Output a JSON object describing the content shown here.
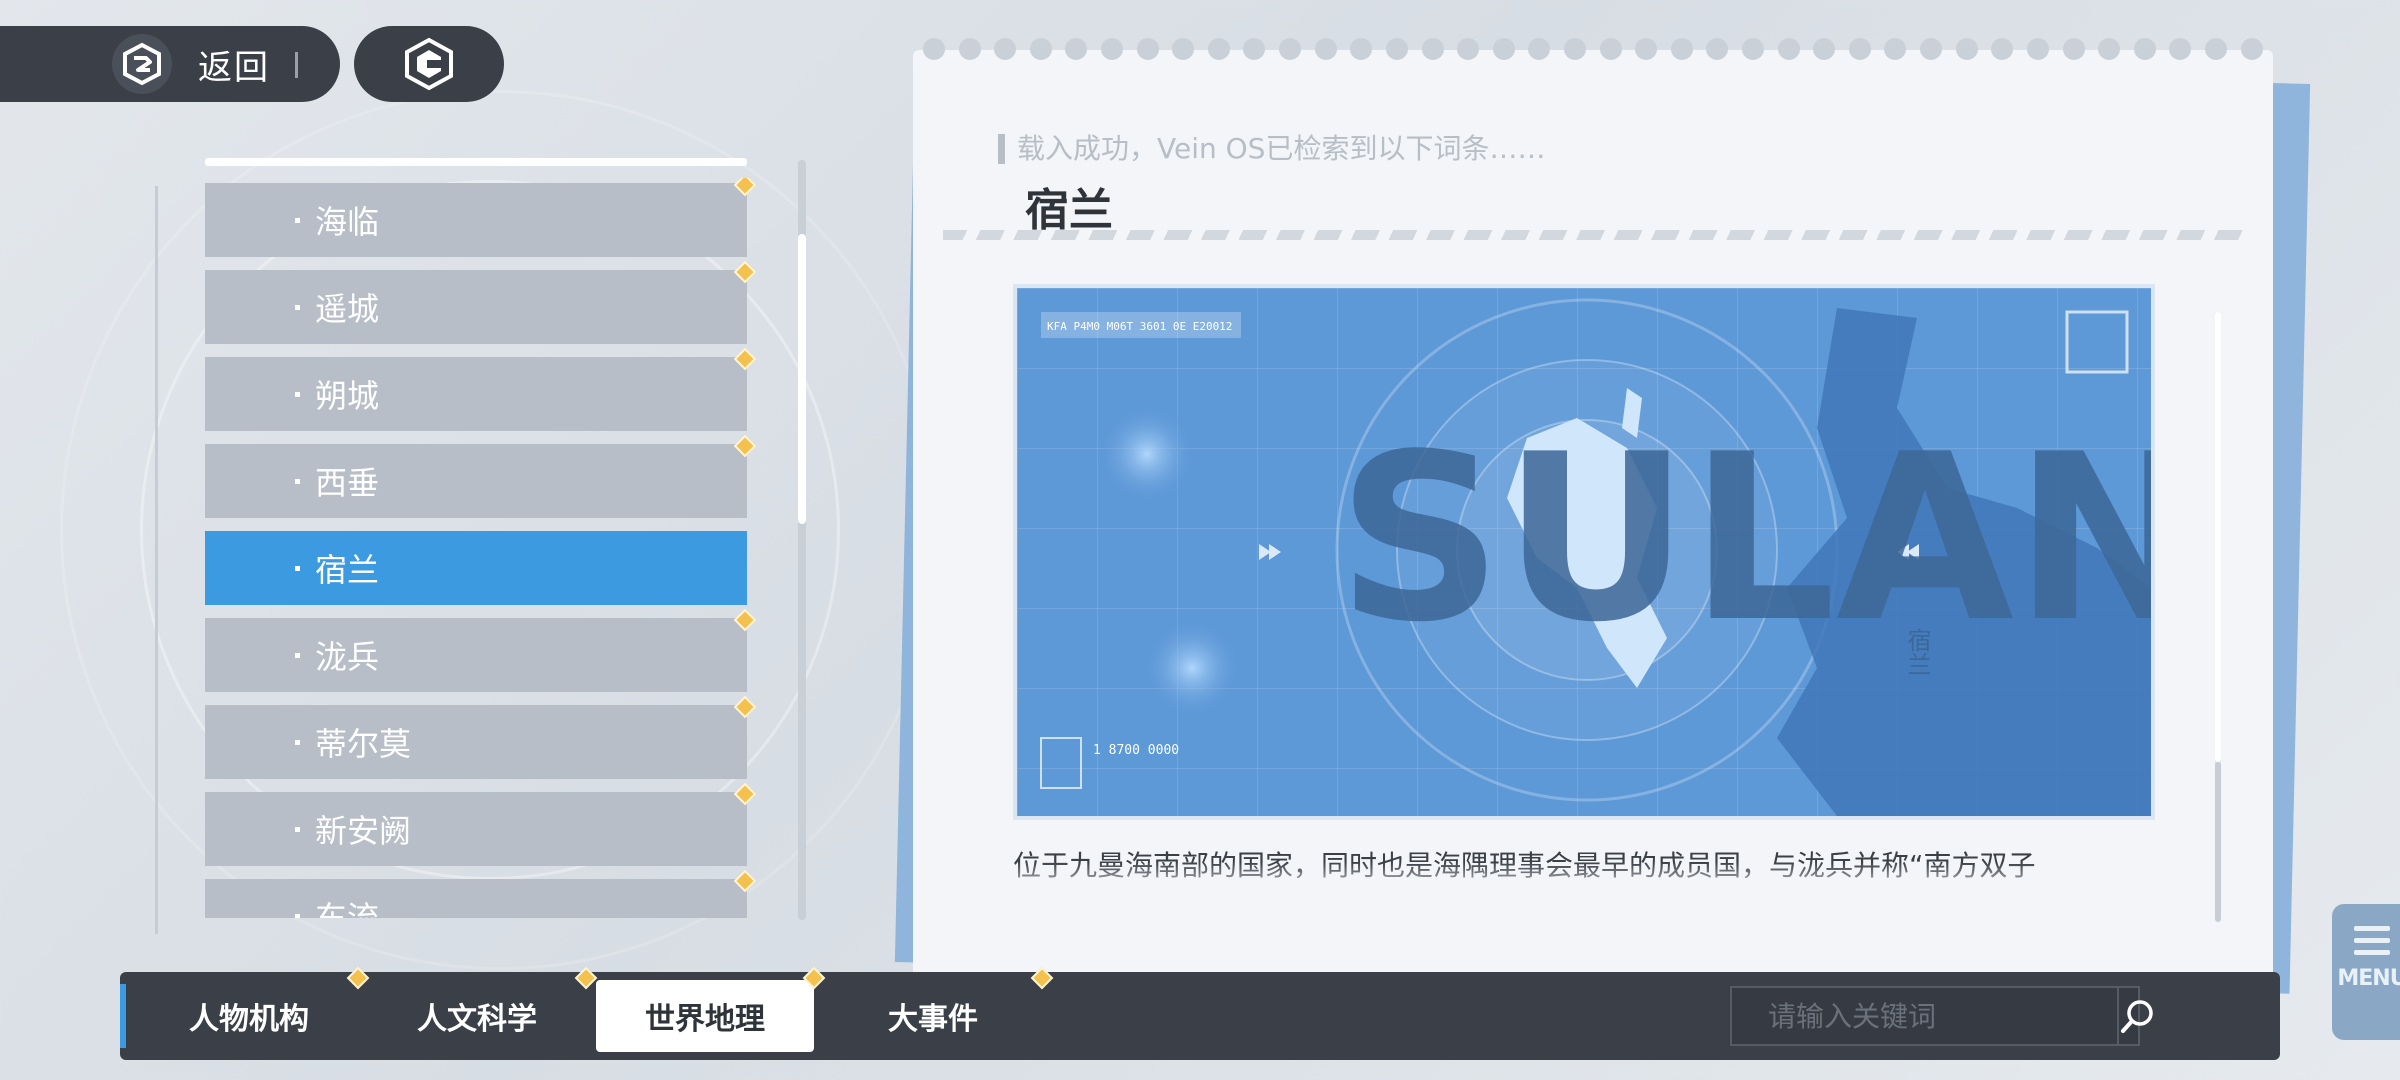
{
  "nav": {
    "back_label": "返回"
  },
  "list": {
    "items": [
      {
        "label": "海临",
        "active": false,
        "new": true
      },
      {
        "label": "遥城",
        "active": false,
        "new": true
      },
      {
        "label": "朔城",
        "active": false,
        "new": true
      },
      {
        "label": "西垂",
        "active": false,
        "new": true
      },
      {
        "label": "宿兰",
        "active": true,
        "new": false
      },
      {
        "label": "泷兵",
        "active": false,
        "new": true
      },
      {
        "label": "蒂尔莫",
        "active": false,
        "new": true
      },
      {
        "label": "新安阙",
        "active": false,
        "new": true
      },
      {
        "label": "东流",
        "active": false,
        "new": true
      }
    ]
  },
  "entry": {
    "prompt": "载入成功，Vein OS已检索到以下词条……",
    "title": "宿兰",
    "map_word": "SULAN",
    "map_vertical_label": "宿兰",
    "map_tag_top": "KFA P4M0 M06T 3601 0E E20012",
    "map_stat": "1 8700 0000",
    "description": "位于九曼海南部的国家，同时也是海隅理事会最早的成员国，与泷兵并称“南方双子"
  },
  "tabs": [
    {
      "label": "人物机构",
      "active": false,
      "new": true
    },
    {
      "label": "人文科学",
      "active": false,
      "new": true
    },
    {
      "label": "世界地理",
      "active": true,
      "new": true
    },
    {
      "label": "大事件",
      "active": false,
      "new": true
    }
  ],
  "search": {
    "placeholder": "请输入关键词"
  },
  "menu": {
    "label": "MENU"
  },
  "colors": {
    "accent": "#3c9be0",
    "dark_bar": "#3a3f48",
    "new_marker": "#f5c14e",
    "list_item": "#b7bec7"
  }
}
